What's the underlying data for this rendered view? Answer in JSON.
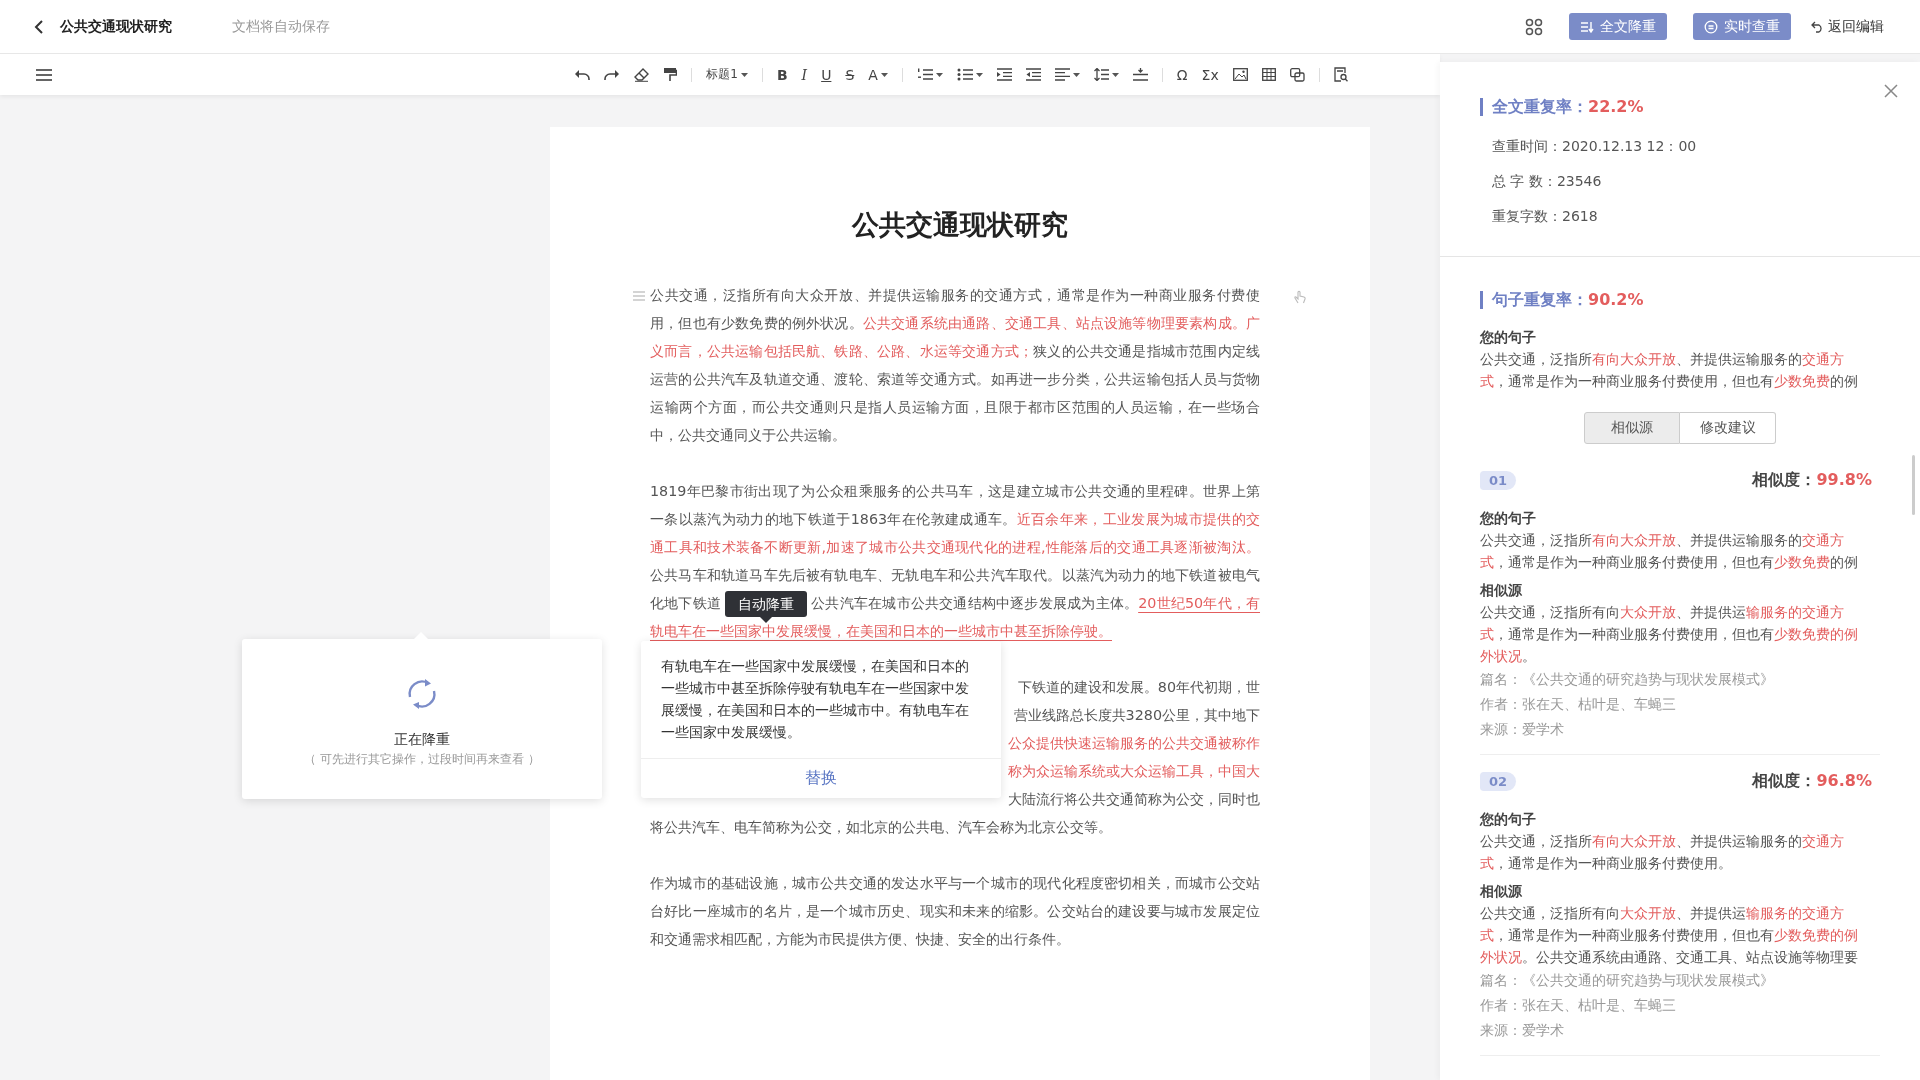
{
  "header": {
    "title": "公共交通现状研究",
    "save_status": "文档将自动保存",
    "buttons": [
      {
        "kind": "full",
        "label": "全文降重"
      },
      {
        "kind": "live",
        "label": "实时查重"
      }
    ],
    "back_edit": "返回编辑"
  },
  "toolbar": [
    {
      "kind": "undo"
    },
    {
      "kind": "redo"
    },
    {
      "kind": "eraser"
    },
    {
      "kind": "brush"
    },
    {
      "kind": "sep"
    },
    {
      "kind": "dropdown",
      "text": "标题1"
    },
    {
      "kind": "sep"
    },
    {
      "kind": "bold",
      "text": "B"
    },
    {
      "kind": "italic",
      "text": "I"
    },
    {
      "kind": "underline",
      "text": "U"
    },
    {
      "kind": "strike",
      "text": "S"
    },
    {
      "kind": "glyph-dropdown",
      "text": "A"
    },
    {
      "kind": "sep"
    },
    {
      "kind": "ordered-list"
    },
    {
      "kind": "bullet-list"
    },
    {
      "kind": "indent"
    },
    {
      "kind": "outdent"
    },
    {
      "kind": "align"
    },
    {
      "kind": "line-height"
    },
    {
      "kind": "spacing"
    },
    {
      "kind": "sep"
    },
    {
      "kind": "symbol",
      "text": "Ω"
    },
    {
      "kind": "symbol",
      "text": "Σx"
    },
    {
      "kind": "image"
    },
    {
      "kind": "table"
    },
    {
      "kind": "copy"
    },
    {
      "kind": "sep"
    },
    {
      "kind": "doc-search"
    }
  ],
  "document": {
    "title": "公共交通现状研究",
    "paragraphs": [
      {
        "segments": [
          {
            "kind": "plain",
            "text": "公共交通，泛指所有向大众开放、并提供运输服务的交通方式，通常是作为一种商业服务付费使用，但也有少数免费的例外状况。"
          },
          {
            "kind": "red",
            "text": "公共交通系统由通路、交通工具、站点设施等物理要素构成。广义而言，公共运输包括民航、铁路、公路、水运等交通方式；"
          },
          {
            "kind": "plain",
            "text": "狭义的公共交通是指城市范围内定线运营的公共汽车及轨道交通、渡轮、索道等交通方式。如再进一步分类，公共运输包括人员与货物运输两个方面，而公共交通则只是指人员运输方面，且限于都市区范围的人员运输，在一些场合中，公共交通同义于公共运输。"
          }
        ]
      },
      {
        "segments": [
          {
            "kind": "plain",
            "text": "1819年巴黎市街出现了为公众租乘服务的公共马车，这是建立城市公共交通的里程碑。世界上第一条以蒸汽为动力的地下铁道于1863年在伦敦建成通车。"
          },
          {
            "kind": "red",
            "text": "近百余年来，工业发展为城市提供的交通工具和技术装备不断更新,加速了城市公共交通现代化的进程,性能落后的交通工具逐渐被淘汰。"
          },
          {
            "kind": "plain",
            "text": "公共马车和轨道马车先后被有轨电车、无轨电车和公共汽车取代。以蒸汽为动力的地下铁道被电气化地下铁道"
          },
          {
            "kind": "tooltip",
            "text": "自动降重"
          },
          {
            "kind": "plain",
            "text": "公共汽车在城市公共交通结构中逐步发展成为主体。"
          },
          {
            "kind": "underlined",
            "text": "20世纪50年代，有轨电车在一些国家中发展缓慢，在美国和日本的一些城市中甚至拆除停驶。"
          }
        ]
      }
    ],
    "covered_paragraph": [
      {
        "kind": "plain",
        "text": "下铁道的建设和发展。80年代初期，世"
      },
      {
        "kind": "plain",
        "text": "营业线路总长度共3280公里，其中地下"
      },
      {
        "kind": "red",
        "text": "公众提供快速运输服务的公共交通被称作"
      },
      {
        "kind": "red",
        "text": "称为众运输系统或大众运输工具，中国大"
      },
      {
        "kind": "plain",
        "text": "大陆流行将公共交通简称为公交，同时也"
      },
      {
        "kind": "full",
        "text": "将公共汽车、电车简称为公交，如北京的公共电、汽车会称为北京公交等。"
      }
    ],
    "last_paragraph": "作为城市的基础设施，城市公共交通的发达水平与一个城市的现代化程度密切相关，而城市公交站台好比一座城市的名片，是一个城市历史、现实和未来的缩影。公交站台的建设要与城市发展定位和交通需求相匹配，方能为市民提供方便、快捷、安全的出行条件。"
  },
  "loading_popup": {
    "title": "正在降重",
    "hint": "（ 可先进行其它操作，过段时间再来查看 ）"
  },
  "replace_popup": {
    "text": "有轨电车在一些国家中发展缓慢，在美国和日本的一些城市中甚至拆除停驶有轨电车在一些国家中发展缓慢，在美国和日本的一些城市中。有轨电车在一些国家中发展缓慢。",
    "action": "替换"
  },
  "panel": {
    "summary": {
      "title": "全文重复率：",
      "rate": "22.2%",
      "rows": [
        "查重时间：2020.12.13 12：00",
        "总 字 数：23546",
        "重复字数：2618"
      ]
    },
    "sentence": {
      "title": "句子重复率：",
      "rate": "90.2%",
      "label": "您的句子",
      "segments": [
        {
          "red": false,
          "text": "公共交通，泛指所"
        },
        {
          "red": true,
          "text": "有向大众开放"
        },
        {
          "red": false,
          "text": "、并提供运输服务的"
        },
        {
          "red": true,
          "text": "交通方式"
        },
        {
          "red": false,
          "text": "，通常是作为一种商业服务付费使用，但也有"
        },
        {
          "red": true,
          "text": "少数免费"
        },
        {
          "red": false,
          "text": "的例"
        }
      ]
    },
    "tabs": [
      {
        "label": "相似源",
        "selected": true
      },
      {
        "label": "修改建议",
        "selected": false
      }
    ],
    "sources": [
      {
        "index": "01",
        "similarity_label": "相似度：",
        "similarity": "99.8%",
        "blocks": [
          {
            "label": "您的句子",
            "segments": [
              {
                "red": false,
                "text": "公共交通，泛指所"
              },
              {
                "red": true,
                "text": "有向大众开放"
              },
              {
                "red": false,
                "text": "、并提供运输服务的"
              },
              {
                "red": true,
                "text": "交通方式"
              },
              {
                "red": false,
                "text": "，通常是作为一种商业服务付费使用，但也有"
              },
              {
                "red": true,
                "text": "少数免费"
              },
              {
                "red": false,
                "text": "的例"
              }
            ]
          },
          {
            "label": "相似源",
            "segments": [
              {
                "red": false,
                "text": "公共交通，泛指所有向"
              },
              {
                "red": true,
                "text": "大众开放"
              },
              {
                "red": false,
                "text": "、并提供运"
              },
              {
                "red": true,
                "text": "输服务的交通方式"
              },
              {
                "red": false,
                "text": "，通常是作为一种商业服务付费使用，但也有"
              },
              {
                "red": true,
                "text": "少数免费的例外状况"
              },
              {
                "red": false,
                "text": "。"
              }
            ]
          }
        ],
        "meta": [
          "篇名：《公共交通的研究趋势与现状发展模式》",
          "作者：张在天、枯叶是、车蝇三",
          "来源：爱学术"
        ]
      },
      {
        "index": "02",
        "similarity_label": "相似度：",
        "similarity": "96.8%",
        "blocks": [
          {
            "label": "您的句子",
            "segments": [
              {
                "red": false,
                "text": "公共交通，泛指所"
              },
              {
                "red": true,
                "text": "有向大众开放"
              },
              {
                "red": false,
                "text": "、并提供运输服务的"
              },
              {
                "red": true,
                "text": "交通方式"
              },
              {
                "red": false,
                "text": "，通常是作为一种商业服务付费使用。"
              }
            ]
          },
          {
            "label": "相似源",
            "segments": [
              {
                "red": false,
                "text": "公共交通，泛指所有向"
              },
              {
                "red": true,
                "text": "大众开放"
              },
              {
                "red": false,
                "text": "、并提供运"
              },
              {
                "red": true,
                "text": "输服务的交通方式"
              },
              {
                "red": false,
                "text": "，通常是作为一种商业服务付费使用，但也有"
              },
              {
                "red": true,
                "text": "少数免费的例外状况"
              },
              {
                "red": false,
                "text": "。公共交通系统由通路、交通工具、站点设施等物理要"
              }
            ]
          }
        ],
        "meta": [
          "篇名：《公共交通的研究趋势与现状发展模式》",
          "作者：张在天、枯叶是、车蝇三",
          "来源：爱学术"
        ]
      }
    ]
  }
}
